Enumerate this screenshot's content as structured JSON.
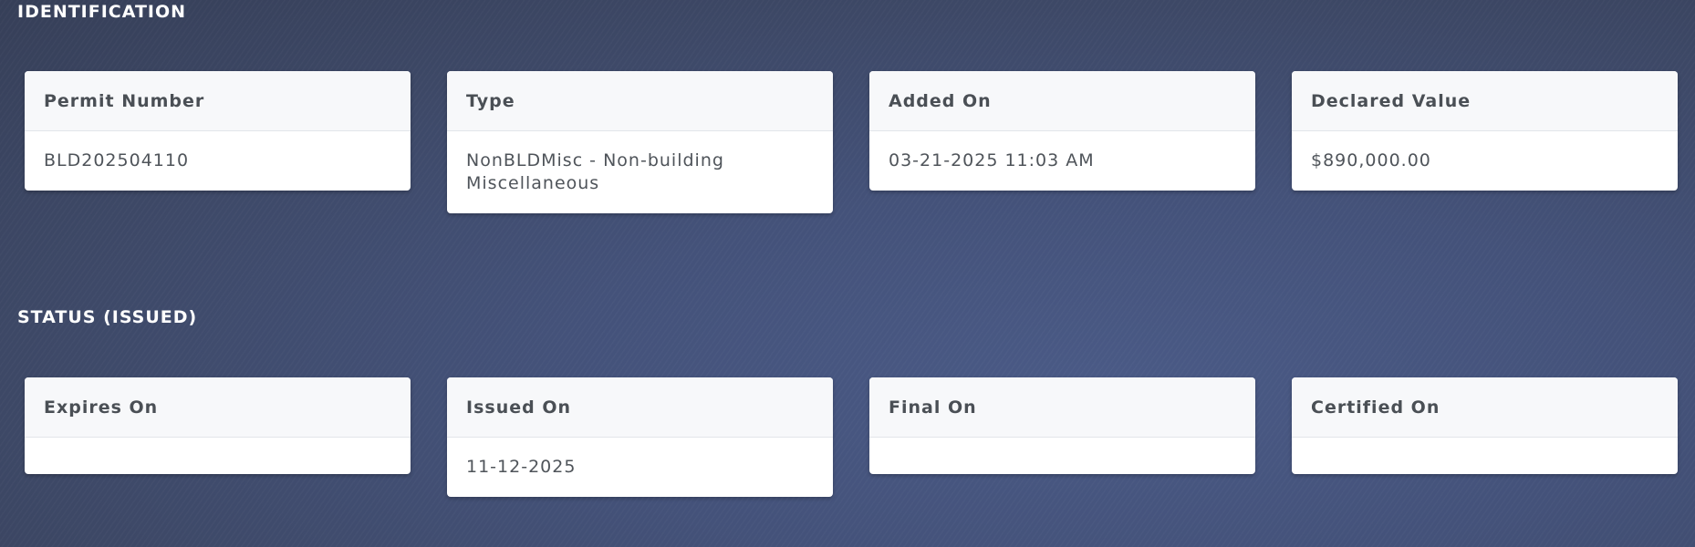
{
  "identification": {
    "title": "IDENTIFICATION",
    "cards": {
      "permit_number": {
        "label": "Permit Number",
        "value": "BLD202504110"
      },
      "type": {
        "label": "Type",
        "value": "NonBLDMisc - Non-building Miscellaneous"
      },
      "added_on": {
        "label": "Added On",
        "value": "03-21-2025 11:03 AM"
      },
      "declared_value": {
        "label": "Declared Value",
        "value": "$890,000.00"
      }
    }
  },
  "status": {
    "title": "STATUS (ISSUED)",
    "cards": {
      "expires_on": {
        "label": "Expires On",
        "value": ""
      },
      "issued_on": {
        "label": "Issued On",
        "value": "11-12-2025"
      },
      "final_on": {
        "label": "Final On",
        "value": ""
      },
      "certified_on": {
        "label": "Certified On",
        "value": ""
      }
    }
  },
  "colors": {
    "background": "#44527a",
    "card_header": "#f7f8fa",
    "card_body": "#ffffff",
    "label_text": "#4a4f55",
    "section_title": "#ffffff"
  }
}
